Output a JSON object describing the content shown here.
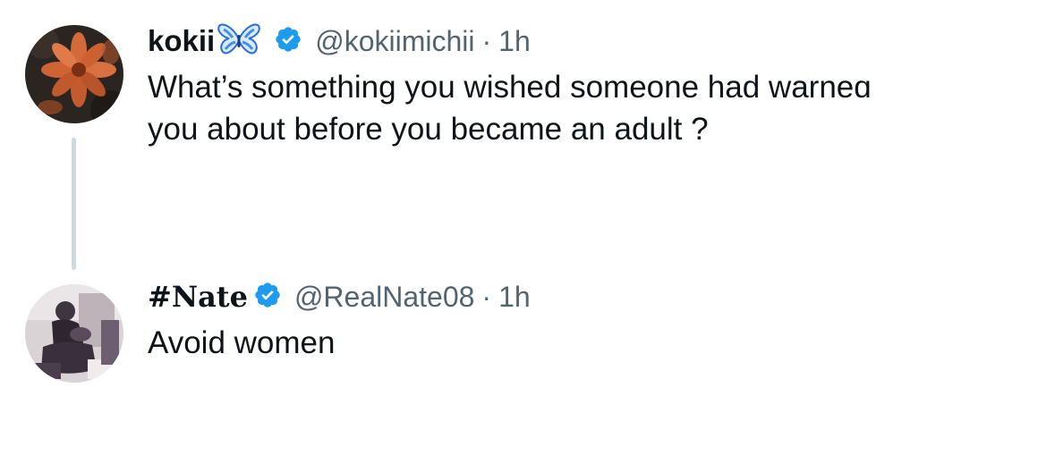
{
  "thread": {
    "tweets": [
      {
        "display_name": "kokii",
        "name_emoji": "butterfly-emoji",
        "verified": true,
        "handle": "@kokiimichii",
        "separator": "·",
        "time": "1h",
        "text_line1": "What’s something you wished someone had warneɑ",
        "text_line2": "you about before you became an adult ?"
      },
      {
        "display_name": "#Nate",
        "verified": true,
        "handle": "@RealNate08",
        "separator": "·",
        "time": "1h",
        "text": "Avoid women"
      }
    ]
  },
  "colors": {
    "text_primary": "#0f1419",
    "text_secondary": "#536471",
    "verified_badge": "#1d9bf0",
    "thread_line": "#cfd9de",
    "butterfly": "#4a8fe7"
  }
}
